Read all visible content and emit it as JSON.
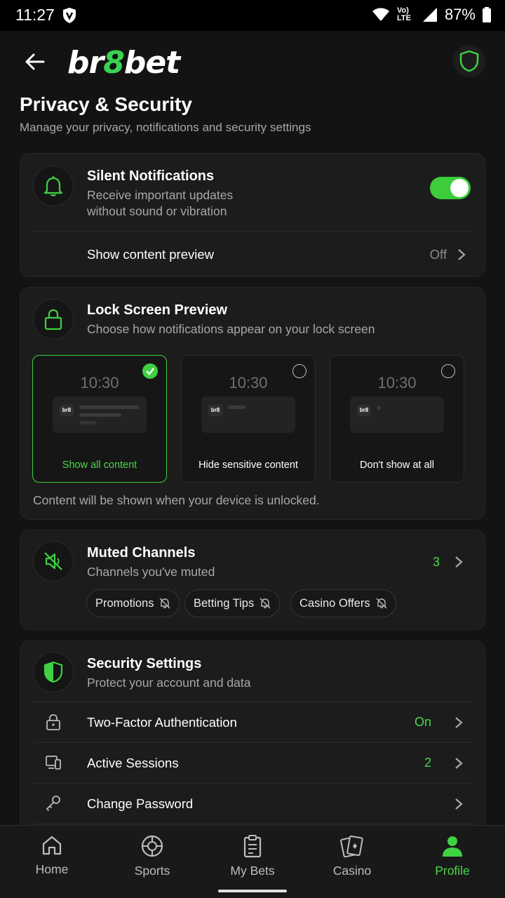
{
  "status_bar": {
    "time": "11:27",
    "network": "Vo) LTE",
    "battery": "87%"
  },
  "header": {
    "logo_part1": "br",
    "logo_part2": "8",
    "logo_part3": "bet"
  },
  "page": {
    "title": "Privacy & Security",
    "subtitle": "Manage your privacy, notifications and security settings"
  },
  "silent_notifications": {
    "title": "Silent Notifications",
    "desc_line1": "Receive important updates",
    "desc_line2": "without sound or vibration",
    "enabled": true,
    "preview_label": "Show content preview",
    "preview_value": "Off"
  },
  "lock_screen": {
    "title": "Lock Screen Preview",
    "desc": "Choose how notifications appear on your lock screen",
    "options": [
      {
        "time": "10:30",
        "label": "Show all content",
        "logo": "br8",
        "selected": true
      },
      {
        "time": "10:30",
        "label": "Hide sensitive content",
        "logo": "br8",
        "selected": false
      },
      {
        "time": "10:30",
        "label": "Don't show at all",
        "logo": "br8",
        "selected": false
      }
    ],
    "footer": "Content will be shown when your device is unlocked."
  },
  "muted_channels": {
    "title": "Muted Channels",
    "desc": "Channels you've muted",
    "count": "3",
    "chips": [
      "Promotions",
      "Betting Tips",
      "Casino Offers"
    ]
  },
  "security": {
    "title": "Security Settings",
    "desc": "Protect your account and data",
    "rows": [
      {
        "label": "Two-Factor Authentication",
        "value": "On",
        "icon": "lock-icon"
      },
      {
        "label": "Active Sessions",
        "value": "2",
        "icon": "devices-icon"
      },
      {
        "label": "Change Password",
        "value": "",
        "icon": "key-icon"
      }
    ]
  },
  "nav": {
    "items": [
      {
        "label": "Home",
        "icon": "home-icon"
      },
      {
        "label": "Sports",
        "icon": "ball-icon"
      },
      {
        "label": "My Bets",
        "icon": "clipboard-icon"
      },
      {
        "label": "Casino",
        "icon": "cards-icon"
      },
      {
        "label": "Profile",
        "icon": "user-icon"
      }
    ],
    "active": "Profile"
  },
  "colors": {
    "accent": "#3fd043",
    "background": "#131313",
    "card": "#1c1c1c"
  }
}
